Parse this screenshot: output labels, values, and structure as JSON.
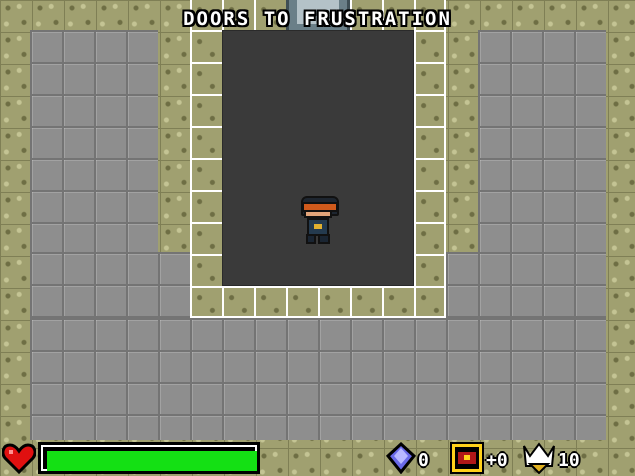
{
  "screen": {
    "title": "DOORS TO FRUSTRATION"
  },
  "player": {
    "name": "player-character"
  },
  "hud": {
    "health_fraction": 1.0,
    "gem_count": "0",
    "chest_count": "+0",
    "crown_count": "10",
    "icons": [
      "heart-icon",
      "gem-icon",
      "chest-icon",
      "crown-icon"
    ]
  },
  "colors": {
    "health_bar": "#14e014",
    "wall": "#a0a070",
    "floor": "#8e8e8e",
    "room_interior": "#3a3a3a"
  }
}
